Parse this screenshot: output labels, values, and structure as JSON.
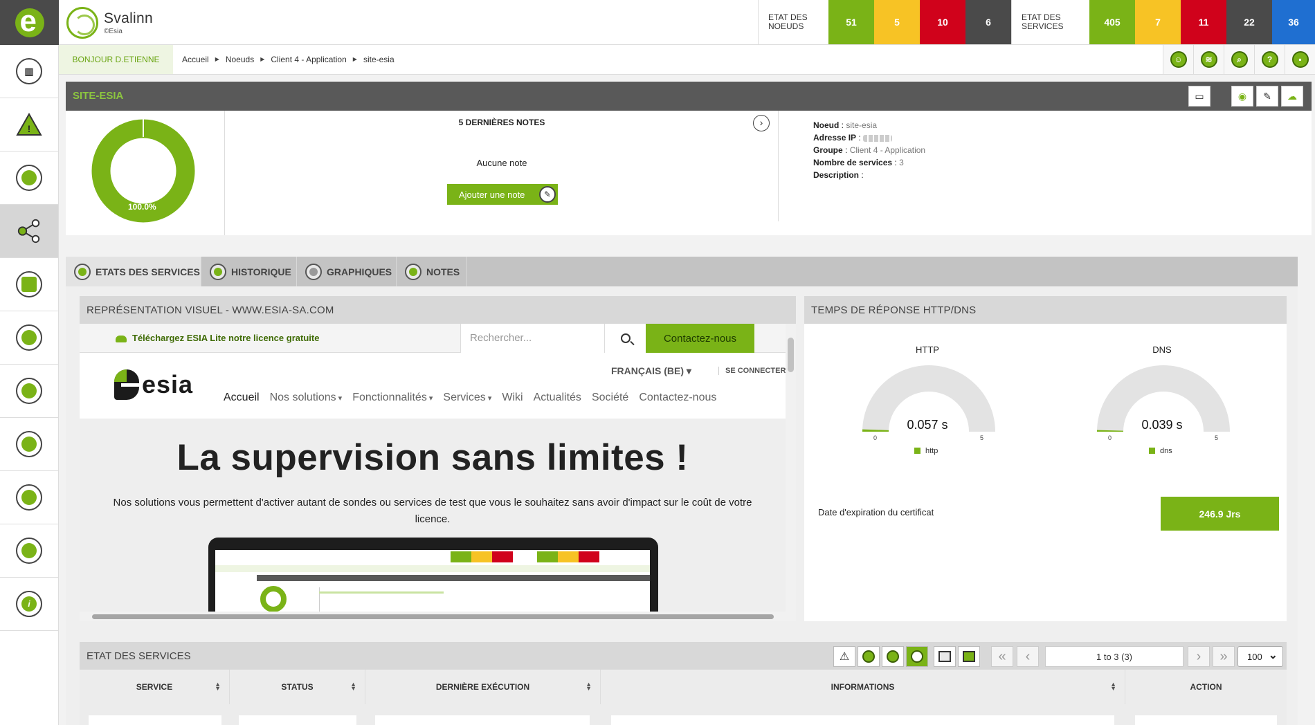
{
  "app": {
    "name": "Svalinn",
    "sub": "©Esia"
  },
  "stats": {
    "nodes_label": "ETAT DES NOEUDS",
    "nodes": [
      {
        "value": "51",
        "color": "#7ab317"
      },
      {
        "value": "5",
        "color": "#f7c325"
      },
      {
        "value": "10",
        "color": "#d0021b"
      },
      {
        "value": "6",
        "color": "#4a4a4a"
      }
    ],
    "services_label": "ETAT DES SERVICES",
    "services": [
      {
        "value": "405",
        "color": "#7ab317"
      },
      {
        "value": "7",
        "color": "#f7c325"
      },
      {
        "value": "11",
        "color": "#d0021b"
      },
      {
        "value": "22",
        "color": "#4a4a4a"
      },
      {
        "value": "36",
        "color": "#1f6fd1"
      }
    ]
  },
  "sidebar": [
    {
      "icon": "dashboard-chart-icon"
    },
    {
      "icon": "alert-triangle-icon"
    },
    {
      "icon": "history-clock-icon"
    },
    {
      "icon": "share-nodes-icon",
      "active": true
    },
    {
      "icon": "report-list-icon"
    },
    {
      "icon": "satellite-icon"
    },
    {
      "icon": "users-group-icon"
    },
    {
      "icon": "network-map-icon"
    },
    {
      "icon": "layers-icon"
    },
    {
      "icon": "settings-gear-icon"
    },
    {
      "icon": "info-icon"
    }
  ],
  "greeting": "BONJOUR D.ETIENNE",
  "breadcrumb": [
    "Accueil",
    "Noeuds",
    "Client 4 - Application",
    "site-esia"
  ],
  "header_tools": [
    "user-icon",
    "rss-icon",
    "search-icon",
    "help-icon",
    "lock-icon"
  ],
  "node": {
    "title": "SITE-ESIA",
    "availability": "100.0%",
    "notes_title": "5 DERNIÈRES NOTES",
    "notes_empty": "Aucune note",
    "add_note": "Ajouter une note",
    "info": {
      "node_label": "Noeud",
      "node_value": "site-esia",
      "ip_label": "Adresse IP",
      "group_label": "Groupe",
      "group_value": "Client 4 - Application",
      "services_label": "Nombre de services",
      "services_value": "3",
      "description_label": "Description",
      "description_value": ""
    }
  },
  "tabs": [
    {
      "label": "ETATS DES SERVICES",
      "active": true
    },
    {
      "label": "HISTORIQUE"
    },
    {
      "label": "GRAPHIQUES"
    },
    {
      "label": "NOTES"
    }
  ],
  "visual": {
    "title": "REPRÉSENTATION VISUEL - WWW.ESIA-SA.COM",
    "site": {
      "download": "Téléchargez ESIA Lite notre licence gratuite",
      "search_placeholder": "Rechercher...",
      "contact_btn": "Contactez-nous",
      "lang": "FRANÇAIS (BE) ▾",
      "login": "SE CONNECTER",
      "logo_text": "esia",
      "nav": [
        "Accueil",
        "Nos solutions",
        "Fonctionnalités",
        "Services",
        "Wiki",
        "Actualités",
        "Société",
        "Contactez-nous"
      ],
      "hero_title": "La supervision sans limites !",
      "hero_text": "Nos solutions vous permettent d'activer autant de sondes ou services de test que vous le souhaitez sans avoir d'impact sur le coût de votre licence."
    }
  },
  "response": {
    "title": "TEMPS DE RÉPONSE HTTP/DNS",
    "gauges": [
      {
        "title": "HTTP",
        "value": 0.057,
        "display": "0.057 s",
        "min": "0",
        "max": "5",
        "legend": "http"
      },
      {
        "title": "DNS",
        "value": 0.039,
        "display": "0.039 s",
        "min": "0",
        "max": "5",
        "legend": "dns"
      }
    ],
    "cert_label": "Date d'expiration du certificat",
    "cert_value": "246.9 Jrs"
  },
  "services_table": {
    "title": "ETAT DES SERVICES",
    "pager_info": "1 to 3 (3)",
    "page_size": "100",
    "columns": [
      "SERVICE",
      "STATUS",
      "DERNIÈRE EXÉCUTION",
      "INFORMATIONS",
      "ACTION"
    ]
  },
  "colors": {
    "accent": "#7ab317",
    "dark": "#595959"
  }
}
